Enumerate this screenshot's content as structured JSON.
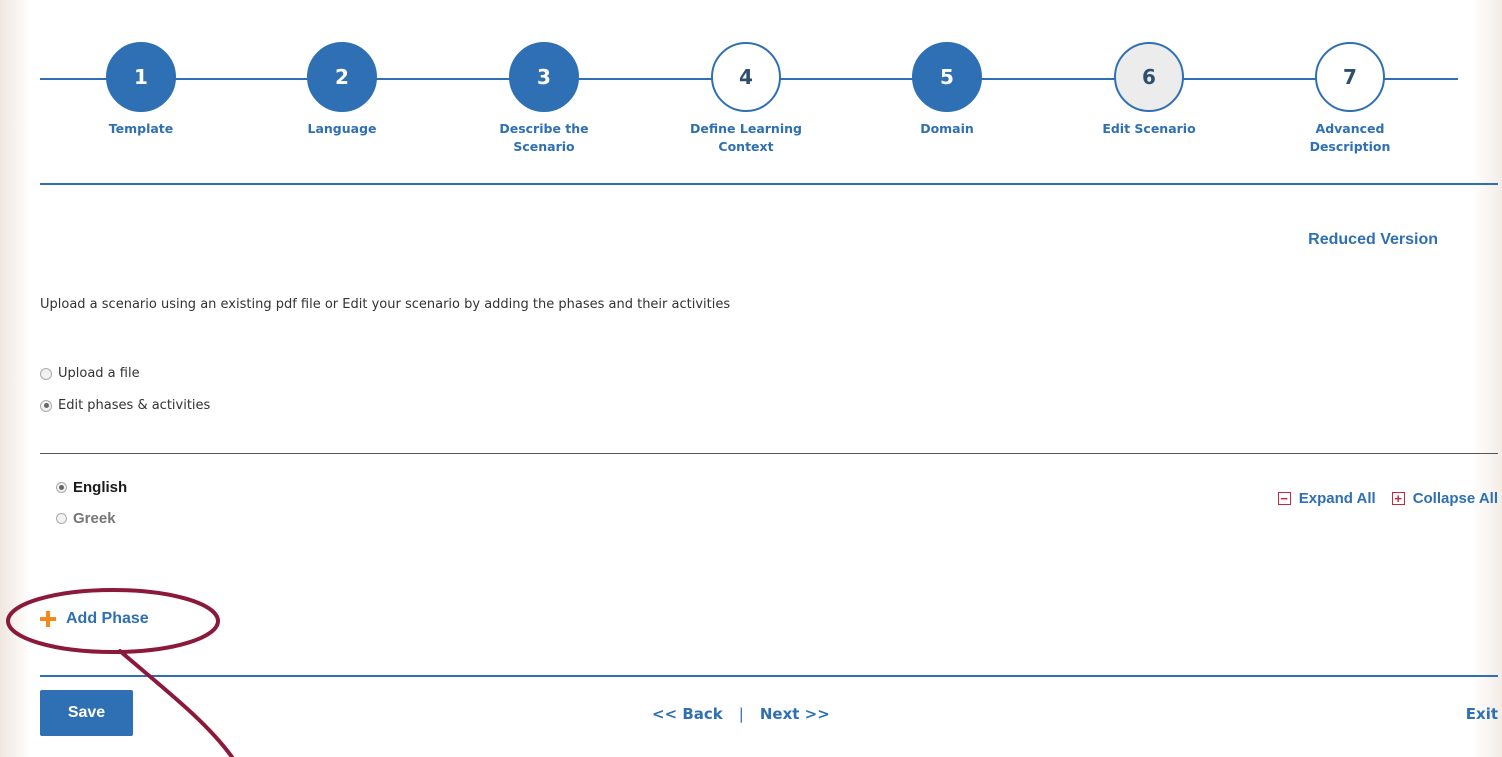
{
  "wizard": {
    "steps": [
      {
        "number": "1",
        "label": "Template",
        "state": "done"
      },
      {
        "number": "2",
        "label": "Language",
        "state": "done"
      },
      {
        "number": "3",
        "label": "Describe the Scenario",
        "state": "done"
      },
      {
        "number": "4",
        "label": "Define Learning Context",
        "state": "todo"
      },
      {
        "number": "5",
        "label": "Domain",
        "state": "done"
      },
      {
        "number": "6",
        "label": "Edit Scenario",
        "state": "current"
      },
      {
        "number": "7",
        "label": "Advanced Description",
        "state": "todo"
      }
    ]
  },
  "reduced_version_link": "Reduced Version",
  "intro_text": "Upload a scenario using an existing pdf file or Edit your scenario by adding the phases and their activities",
  "mode_options": [
    {
      "label": "Upload a file",
      "selected": false
    },
    {
      "label": "Edit phases & activities",
      "selected": true
    }
  ],
  "languages": [
    {
      "label": "English",
      "selected": true
    },
    {
      "label": "Greek",
      "selected": false
    }
  ],
  "controls": {
    "expand_all": "Expand All",
    "collapse_all": "Collapse All"
  },
  "add_phase_label": "Add Phase",
  "footer": {
    "save_label": "Save",
    "back_label": "<< Back",
    "separator": "|",
    "next_label": "Next >>",
    "exit_label": "Exit"
  },
  "colors": {
    "primary": "#2f6fb3",
    "annotation": "#8b1a3a",
    "add_icon": "#f28a1b",
    "toggle_icon": "#c6283f"
  }
}
